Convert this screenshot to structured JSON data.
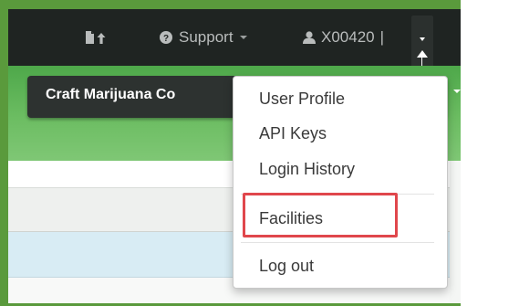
{
  "navbar": {
    "docs_icon": "document-upload-icon",
    "support_label": "Support",
    "support_icon": "question-circle-icon",
    "user_label": "X00420",
    "user_icon": "user-icon",
    "separator": "|"
  },
  "facility": {
    "label": "Craft Marijuana Co"
  },
  "dropdown": {
    "items": [
      {
        "label": "User Profile"
      },
      {
        "label": "API Keys"
      },
      {
        "label": "Login History"
      },
      {
        "label": "Facilities"
      },
      {
        "label": "Log out"
      }
    ],
    "highlight_color": "#e0474c"
  },
  "colors": {
    "navbar": "#1f2422",
    "frame": "#5a9a3c",
    "band": "#6cbd62"
  }
}
